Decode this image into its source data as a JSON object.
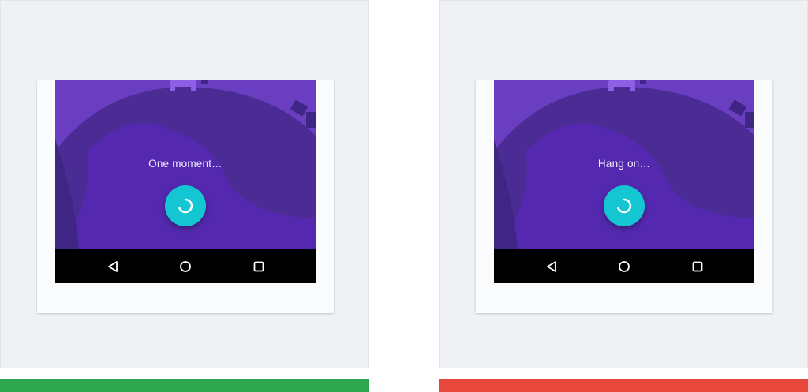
{
  "examples": [
    {
      "id": "good",
      "message": "One moment…",
      "status_color": "#2ea650"
    },
    {
      "id": "bad",
      "message": "Hang on…",
      "status_color": "#e8473b"
    }
  ],
  "icons": {
    "loader": "refresh-spinner-icon",
    "back": "back-triangle-icon",
    "home": "home-circle-icon",
    "recent": "recent-apps-square-icon"
  },
  "colors": {
    "screen_bg": "#6339b8",
    "fab": "#14c6d1",
    "navbar": "#000000"
  }
}
